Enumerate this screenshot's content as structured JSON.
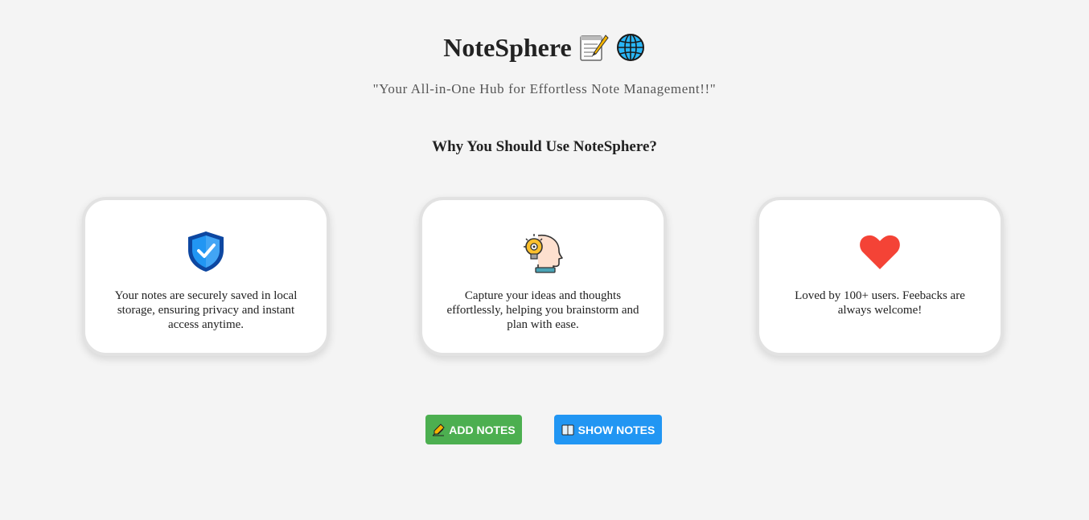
{
  "header": {
    "title": "NoteSphere",
    "title_icons": [
      "memo-icon",
      "globe-icon"
    ],
    "tagline": "\"Your All-in-One Hub for Effortless Note Management!!\""
  },
  "features": {
    "heading": "Why You Should Use NoteSphere?",
    "cards": [
      {
        "icon": "shield-check-icon",
        "text": "Your notes are securely saved in local storage, ensuring privacy and instant access anytime."
      },
      {
        "icon": "idea-head-icon",
        "text": "Capture your ideas and thoughts effortlessly, helping you brainstorm and plan with ease."
      },
      {
        "icon": "heart-icon",
        "text": "Loved by 100+ users. Feebacks are always welcome!"
      }
    ]
  },
  "actions": {
    "add_label": "ADD NOTES",
    "add_icon": "pencil-writing-icon",
    "show_label": "SHOW NOTES",
    "show_icon": "open-book-icon"
  },
  "colors": {
    "background": "#f4f4f4",
    "add_button": "#4caf50",
    "show_button": "#2196f3",
    "heart": "#f44336",
    "shield": "#0d47a1"
  }
}
